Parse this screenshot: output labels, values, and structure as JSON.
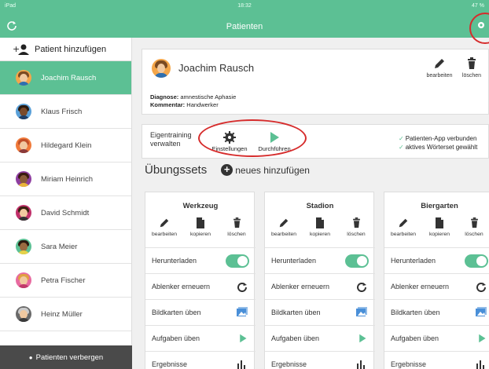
{
  "statusbar": {
    "device": "iPad",
    "time": "18:32",
    "battery": "47 %"
  },
  "nav": {
    "title": "Patienten"
  },
  "sidebar": {
    "add_label": "Patient hinzufügen",
    "patients": [
      {
        "name": "Joachim Rausch",
        "active": true
      },
      {
        "name": "Klaus Frisch",
        "active": false
      },
      {
        "name": "Hildegard Klein",
        "active": false
      },
      {
        "name": "Miriam Heinrich",
        "active": false
      },
      {
        "name": "David Schmidt",
        "active": false
      },
      {
        "name": "Sara Meier",
        "active": false
      },
      {
        "name": "Petra Fischer",
        "active": false
      },
      {
        "name": "Heinz Müller",
        "active": false
      }
    ],
    "hide_label": "Patienten verbergen"
  },
  "patient": {
    "name": "Joachim Rausch",
    "edit_label": "bearbeiten",
    "delete_label": "löschen",
    "diagnosis_label": "Diagnose:",
    "diagnosis_value": "amnestische Aphasie",
    "comment_label": "Kommentar:",
    "comment_value": "Handwerker"
  },
  "training": {
    "label_line1": "Eigentraining",
    "label_line2": "verwalten",
    "settings_label": "Einstellungen",
    "run_label": "Durchführen",
    "status1": "Patienten-App verbunden",
    "status2": "aktives Wörterset gewählt"
  },
  "sets": {
    "title": "Übungssets",
    "add_label": "neues hinzufügen",
    "edit_label": "bearbeiten",
    "copy_label": "kopieren",
    "delete_label": "löschen",
    "rows": {
      "download": "Herunterladen",
      "distractors": "Ablenker erneuern",
      "cards": "Bildkarten üben",
      "tasks": "Aufgaben üben",
      "results": "Ergebnisse"
    },
    "items": [
      {
        "name": "Werkzeug",
        "download": true
      },
      {
        "name": "Stadion",
        "download": true
      },
      {
        "name": "Biergarten",
        "download": true
      }
    ]
  },
  "colors": {
    "accent": "#5cc094",
    "annotation": "#d62c2c",
    "dark": "#4a4a4a"
  }
}
